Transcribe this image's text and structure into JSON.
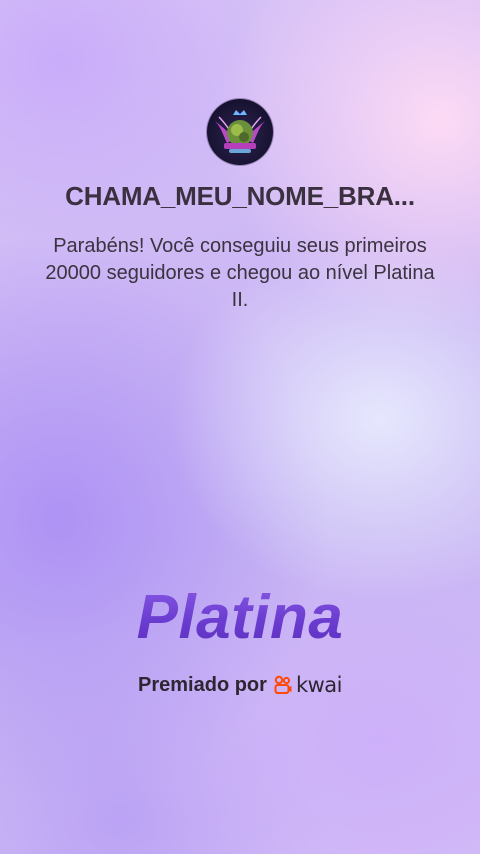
{
  "profile": {
    "username": "CHAMA_MEU_NOME_BRA...",
    "avatar_icon": "avatar-emblem"
  },
  "message": {
    "text": "Parabéns! Você conseguiu seus primeiros 20000 seguidores e chegou ao nível Platina II."
  },
  "achievement": {
    "level_label": "Platina",
    "level_color": "#6a3ccf"
  },
  "footer": {
    "awarded_by": "Premiado por",
    "brand_name": "kwai",
    "brand_icon": "kwai-logo-icon",
    "brand_color": "#ff4906"
  }
}
